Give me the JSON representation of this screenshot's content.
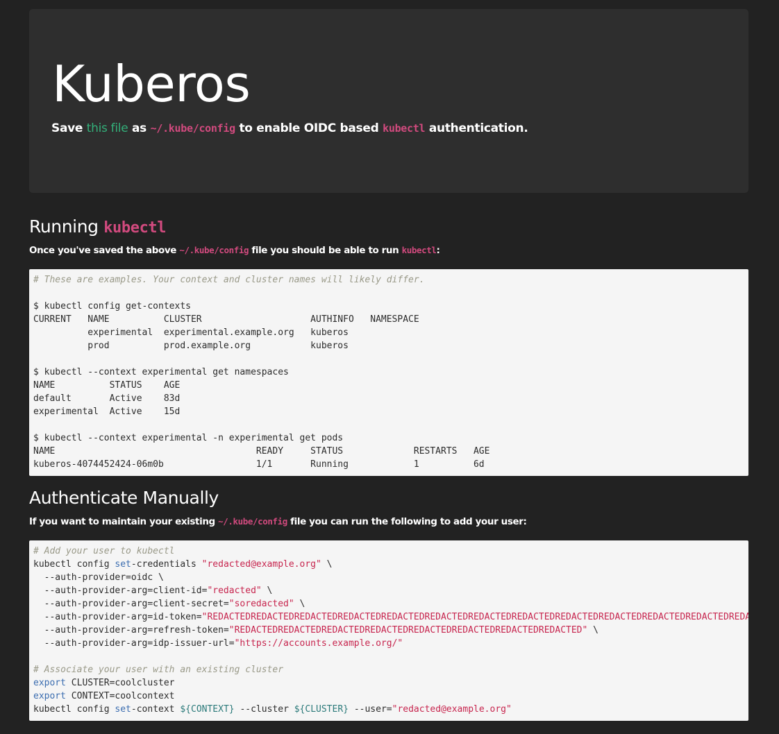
{
  "hero": {
    "title": "Kuberos",
    "lead_save": "Save ",
    "lead_link": "this file",
    "lead_as": " as ",
    "lead_path": "~/.kube/config",
    "lead_to": " to enable OIDC based ",
    "lead_cmd": "kubectl",
    "lead_end": " authentication."
  },
  "running": {
    "heading_prefix": "Running ",
    "heading_code": "kubectl",
    "text_pre": "Once you've saved the above ",
    "text_path": "~/.kube/config",
    "text_mid": " file you should be able to run ",
    "text_cmd": "kubectl",
    "text_end": ":",
    "code_lines": [
      "# These are examples. Your context and cluster names will likely differ.",
      "",
      "$ kubectl config get-contexts",
      "CURRENT   NAME          CLUSTER                    AUTHINFO   NAMESPACE",
      "          experimental  experimental.example.org   kuberos",
      "          prod          prod.example.org           kuberos",
      "",
      "$ kubectl --context experimental get namespaces",
      "NAME          STATUS    AGE",
      "default       Active    83d",
      "experimental  Active    15d",
      "",
      "$ kubectl --context experimental -n experimental get pods",
      "NAME                                     READY     STATUS             RESTARTS   AGE",
      "kuberos-4074452424-06m0b                 1/1       Running            1          6d"
    ]
  },
  "manual": {
    "heading": "Authenticate Manually",
    "text_pre": "If you want to maintain your existing ",
    "text_path": "~/.kube/config",
    "text_end": " file you can run the following to add your user:",
    "comment1": "# Add your user to kubectl",
    "l1_a": "kubectl config ",
    "l1_kw": "set",
    "l1_b": "-credentials ",
    "l1_str": "\"redacted@example.org\"",
    "l1_c": " \\",
    "l2": "  --auth-provider=oidc \\",
    "l3_a": "  --auth-provider-arg=client-id=",
    "l3_str": "\"redacted\"",
    "l3_c": " \\",
    "l4_a": "  --auth-provider-arg=client-secret=",
    "l4_str": "\"soredacted\"",
    "l4_c": " \\",
    "l5_a": "  --auth-provider-arg=id-token=",
    "l5_str": "\"REDACTEDREDACTEDREDACTEDREDACTEDREDACTEDREDACTEDREDACTEDREDACTEDREDACTEDREDACTEDREDACTEDREDACTEDREDACTED\"",
    "l6_a": "  --auth-provider-arg=refresh-token=",
    "l6_str": "\"REDACTEDREDACTEDREDACTEDREDACTEDREDACTEDREDACTEDREDACTEDREDACTED\"",
    "l6_c": " \\",
    "l7_a": "  --auth-provider-arg=idp-issuer-url=",
    "l7_str": "\"https://accounts.example.org/\"",
    "comment2": "# Associate your user with an existing cluster",
    "l8_kw": "export",
    "l8_b": " CLUSTER=coolcluster",
    "l9_kw": "export",
    "l9_b": " CONTEXT=coolcontext",
    "l10_a": "kubectl config ",
    "l10_kw": "set",
    "l10_b": "-context ",
    "l10_var1": "${CONTEXT}",
    "l10_c": " --cluster ",
    "l10_var2": "${CLUSTER}",
    "l10_d": " --user=",
    "l10_str": "\"redacted@example.org\""
  }
}
